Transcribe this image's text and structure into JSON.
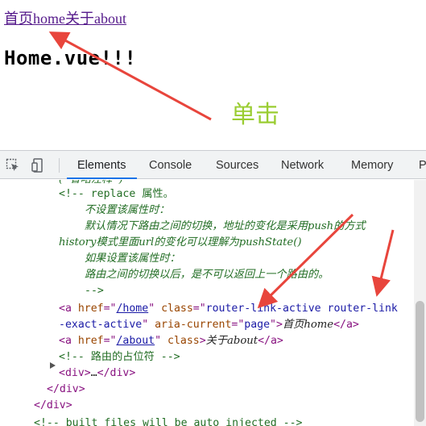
{
  "page": {
    "nav": {
      "home_link": "首页home",
      "about_link": "关于about"
    },
    "heading": "Home.vue!!!",
    "annotation": "单击"
  },
  "devtools": {
    "tabs": [
      {
        "label": "Elements",
        "active": true
      },
      {
        "label": "Console"
      },
      {
        "label": "Sources"
      },
      {
        "label": "Network"
      },
      {
        "label": "Memory"
      },
      {
        "label": "P"
      }
    ],
    "lines": {
      "l0": "(  省略注释  )",
      "l1": "<!-- replace 属性。",
      "l2": "不设置该属性时：",
      "l3": "默认情况下路由之间的切换，地址的变化是采用push的方式",
      "l4": "history模式里面url的变化可以理解为pushState()",
      "l5": "如果设置该属性时：",
      "l6": "路由之间的切换以后，是不可以返回上一个路由的。",
      "l7": "-->",
      "l8": {
        "open": "<a ",
        "href_attr": "href",
        "eq1": "=\"",
        "href_val": "/home",
        "q1": "\" ",
        "class_attr": "class",
        "eq2": "=\"",
        "class_val": "router-link-active router-link"
      },
      "l9": {
        "class_cont": "-exact-active",
        "q1": "\" ",
        "aria_attr": "aria-current",
        "eq": "=\"",
        "aria_val": "page",
        "q2": "\"",
        "gt": ">",
        "text": "首页home",
        "close": "</a>"
      },
      "l10": {
        "open": "<a ",
        "href_attr": "href",
        "eq1": "=\"",
        "href_val": "/about",
        "q1": "\" ",
        "class_attr": "class",
        "gt": ">",
        "text": "关于about",
        "close": "</a>"
      },
      "l11": "<!-- 路由的占位符 -->",
      "l12": {
        "open": "<div>",
        "ellipsis": "…",
        "close": "</div>"
      },
      "l13": "</div>",
      "l14": "</div>",
      "l15": "<!-- built files will be auto injected -->"
    }
  },
  "colors": {
    "annotation": "#9acd32",
    "arrow": "#e8453c",
    "link": "#551a8b",
    "active_tab_underline": "#1a73e8"
  }
}
